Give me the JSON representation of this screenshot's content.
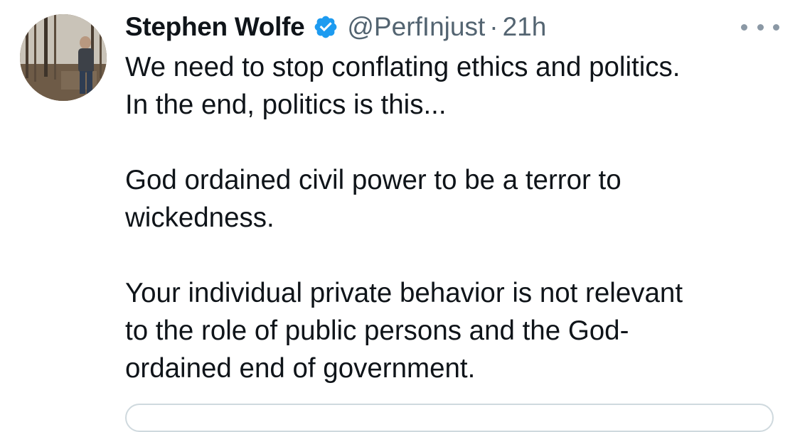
{
  "tweet": {
    "author": {
      "display_name": "Stephen Wolfe",
      "handle": "@PerfInjust",
      "verified": true,
      "avatar_icon": "profile-photo"
    },
    "separator": "·",
    "time": "21h",
    "more_icon": "more-horizontal-icon",
    "text": {
      "line1": "We need to stop conflating ethics and politics.",
      "line2": "In the end, politics is this...",
      "line3": "God ordained civil power to be a terror to",
      "line4": "wickedness.",
      "line5": "Your individual private behavior is not relevant",
      "line6": "to the role of public persons and  the God-",
      "line7": "ordained end of government."
    }
  },
  "colors": {
    "text_primary": "#0f1419",
    "text_secondary": "#536471",
    "verified_blue": "#1d9bf0",
    "border": "#cfd9de"
  }
}
